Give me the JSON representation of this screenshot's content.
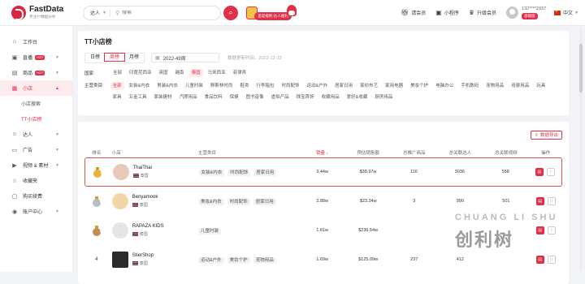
{
  "header": {
    "logo_name": "FastData",
    "logo_sub": "专注TT数据分析",
    "search_region": "达人",
    "search_placeholder": "搜索",
    "promo_text": "圣诞福利·达人福利",
    "invite_label": "请会员",
    "miniapp_label": "小程序",
    "upgrade_label": "升级会员",
    "user_phone": "132****2937",
    "user_badge": "基础版",
    "language": "中文"
  },
  "sidebar": {
    "items": [
      {
        "label": "工作台",
        "icon": "home-icon"
      },
      {
        "label": "直播",
        "icon": "live-icon",
        "hot": "HOT"
      },
      {
        "label": "商品",
        "icon": "goods-icon",
        "hot": "HOT"
      },
      {
        "label": "小店",
        "icon": "shop-icon"
      },
      {
        "label": "达人",
        "icon": "user-icon"
      },
      {
        "label": "广告",
        "icon": "ad-icon"
      },
      {
        "label": "视频 & 素材",
        "icon": "video-icon"
      },
      {
        "label": "收藏夹",
        "icon": "star-icon"
      },
      {
        "label": "购买续费",
        "icon": "cart-icon"
      },
      {
        "label": "账户中心",
        "icon": "account-icon"
      }
    ],
    "sub_items": [
      "小店搜索",
      "TT小店榜"
    ]
  },
  "page": {
    "title": "TT小店榜",
    "period_tabs": [
      "日榜",
      "周榜",
      "月榜"
    ],
    "active_period": "周榜",
    "date_value": "2022-49周",
    "updated": "数据更新时间：2022-12-13",
    "country_label": "国家:",
    "countries": [
      "全部",
      "印度尼西亚",
      "英国",
      "越南",
      "泰国",
      "马来西亚",
      "菲律宾"
    ],
    "active_country": "泰国",
    "category_label": "主营类目:",
    "categories": [
      "全部",
      "女装&内衣",
      "男装&内衣",
      "儿童时装",
      "穆斯林时尚",
      "鞋类",
      "行李箱包",
      "时尚配饰",
      "运动&户外",
      "居家日用",
      "家纺布艺",
      "家用电器",
      "美妆个护",
      "电脑办公",
      "手机数码",
      "宠物用品",
      "母婴用品",
      "玩具",
      "家具",
      "五金工具",
      "家装建材",
      "汽摩用品",
      "食品饮料",
      "保健",
      "图书音像",
      "虚拟产品",
      "珠宝首饰",
      "收藏用品",
      "爱好&收藏",
      "厨房用品"
    ],
    "active_category": "全部",
    "export_label": "数据导出"
  },
  "table": {
    "headers": {
      "rank": "排名",
      "shop": "小店",
      "category": "主营类目",
      "sales": "销量",
      "gmv": "预估销售额",
      "products": "总推广商品",
      "related_creators": "总关联达人",
      "related_lives": "总关联视频",
      "ops": "操作"
    },
    "rows": [
      {
        "rank": "1",
        "name": "ThaiThai",
        "country": "泰国",
        "tags": [
          "女装&内衣",
          "时尚配饰",
          "居家日用"
        ],
        "sales": "3.44w",
        "gmv": "$38.97w",
        "products": "116",
        "creators": "3036",
        "videos": "558",
        "highlight": true
      },
      {
        "rank": "2",
        "name": "Benyamook",
        "country": "泰国",
        "tags": [
          "美妆&内衣",
          "时尚配饰",
          "居家日用"
        ],
        "sales": "2.88w",
        "gmv": "$23.34w",
        "products": "3",
        "creators": "990",
        "videos": "501",
        "highlight": false
      },
      {
        "rank": "3",
        "name": "RAPAZA KIDS",
        "country": "泰国",
        "tags": [
          "儿童时装"
        ],
        "sales": "1.81w",
        "gmv": "$236.54w",
        "products": "",
        "creators": "",
        "videos": "",
        "highlight": false
      },
      {
        "rank": "4",
        "name": "StierShop",
        "country": "泰国",
        "tags": [
          "运动&户外",
          "美妆个护",
          "宠物用品"
        ],
        "sales": "1.69w",
        "gmv": "$125.09w",
        "products": "237",
        "creators": "412",
        "videos": "",
        "highlight": false
      }
    ]
  },
  "watermark": {
    "en": "CHUANG LI SHU",
    "cn": "创利树"
  },
  "colors": {
    "accent": "#e0304a",
    "gold": "#e8b43b",
    "silver": "#b8bcc4",
    "bronze": "#c58b4f"
  }
}
